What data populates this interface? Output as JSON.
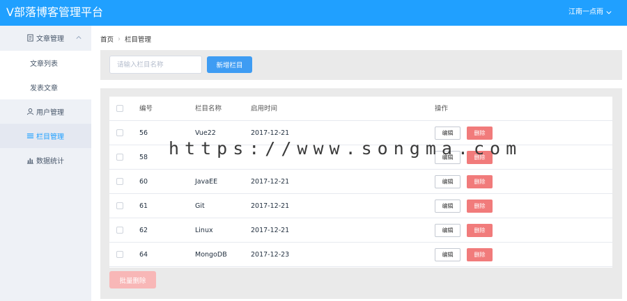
{
  "header": {
    "title": "V部落博客管理平台",
    "user": "江南一点雨"
  },
  "sidebar": {
    "groups": [
      {
        "label": "文章管理",
        "icon": "document-icon",
        "children": [
          "文章列表",
          "发表文章"
        ]
      },
      {
        "label": "用户管理",
        "icon": "user-icon"
      },
      {
        "label": "栏目管理",
        "icon": "menu-icon"
      },
      {
        "label": "数据统计",
        "icon": "bar-chart-icon"
      }
    ]
  },
  "breadcrumb": {
    "home": "首页",
    "current": "栏目管理"
  },
  "toolbar": {
    "search_placeholder": "请输入栏目名称",
    "add_label": "新增栏目"
  },
  "table": {
    "headers": [
      "编号",
      "栏目名称",
      "启用时间",
      "操作"
    ],
    "rows": [
      {
        "id": "56",
        "name": "Vue22",
        "date": "2017-12-21"
      },
      {
        "id": "58",
        "name": "",
        "date": ""
      },
      {
        "id": "60",
        "name": "JavaEE",
        "date": "2017-12-21"
      },
      {
        "id": "61",
        "name": "Git",
        "date": "2017-12-21"
      },
      {
        "id": "62",
        "name": "Linux",
        "date": "2017-12-21"
      },
      {
        "id": "64",
        "name": "MongoDB",
        "date": "2017-12-23"
      }
    ],
    "edit_label": "编辑",
    "delete_label": "删除"
  },
  "batch_delete_label": "批量删除",
  "watermark": "https://www.songma.com",
  "colors": {
    "accent": "#20a0ff",
    "danger": "#f17b7b",
    "sidebar_bg": "#eef1f6"
  }
}
